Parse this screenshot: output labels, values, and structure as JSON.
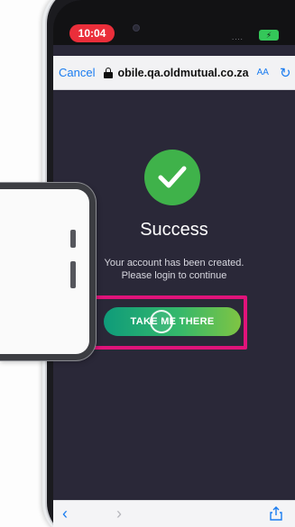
{
  "status_bar": {
    "time": "10:04",
    "signal": "....",
    "battery": "⚡"
  },
  "browser": {
    "cancel_label": "Cancel",
    "url": "obile.qa.oldmutual.co.za",
    "text_size_label": "AA",
    "reload_icon": "reload-icon"
  },
  "success": {
    "icon": "check-circle-icon",
    "icon_color": "#3fb24a",
    "title": "Success",
    "message_line1": "Your account has been created.",
    "message_line2": "Please login to continue",
    "cta_label": "TAKE ME THERE",
    "highlight_color": "#e0137a"
  },
  "bottom_toolbar": {
    "back_icon": "chevron-left-icon",
    "forward_icon": "chevron-right-icon",
    "share_icon": "share-icon"
  }
}
